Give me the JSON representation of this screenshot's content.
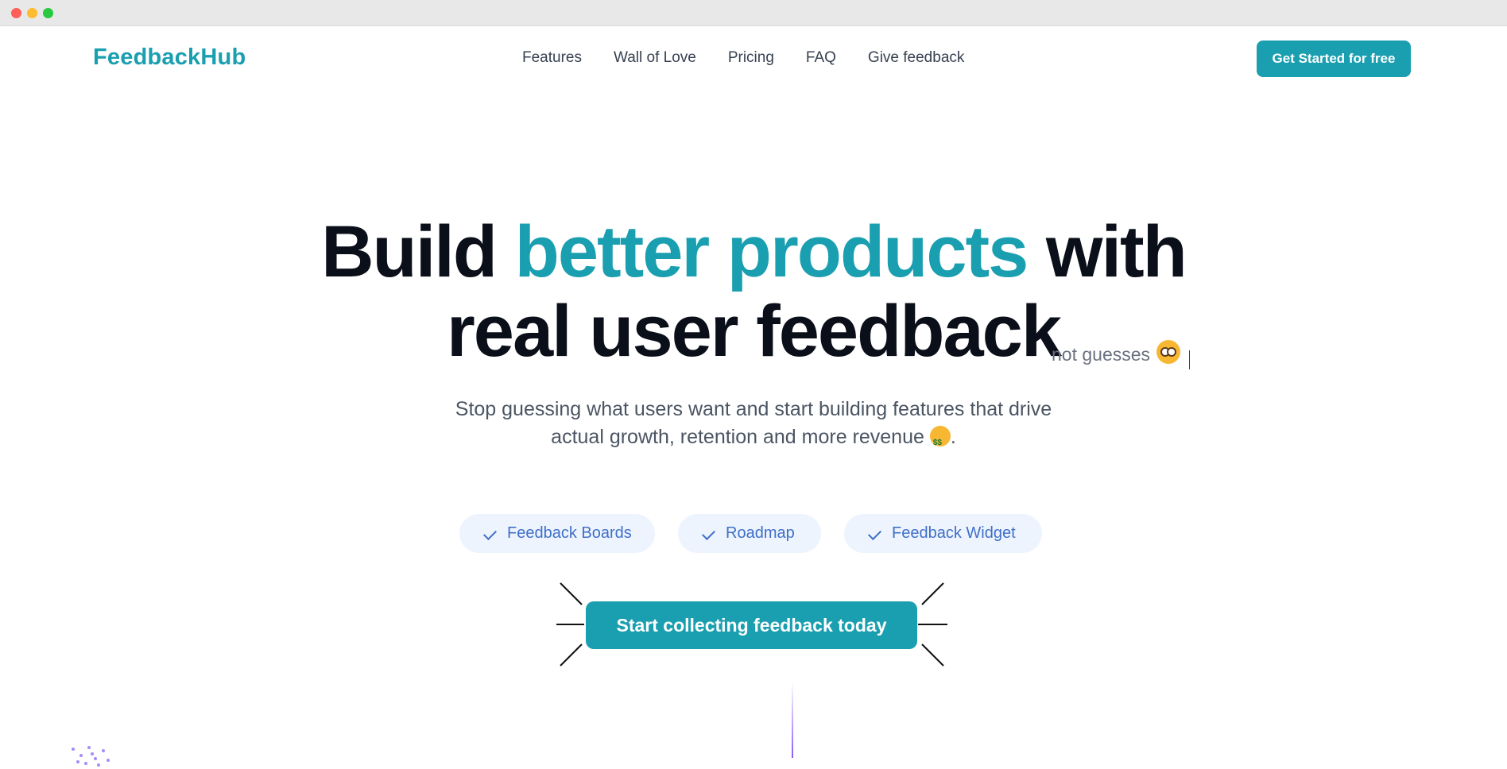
{
  "brand": {
    "name": "FeedbackHub",
    "color": "#1a9fb0"
  },
  "nav": {
    "items": [
      "Features",
      "Wall of Love",
      "Pricing",
      "FAQ",
      "Give feedback"
    ],
    "cta_label": "Get Started for free"
  },
  "hero": {
    "headline_part1": "Build ",
    "headline_accent": "better products",
    "headline_part2": " with",
    "headline_line2": "real user feedback",
    "typed_text": "not guesses",
    "typed_icon": "flushed-face-icon",
    "subtitle": "Stop guessing what users want and start building features that drive actual growth, retention and more revenue",
    "subtitle_icon": "money-mouth-face-icon",
    "subtitle_end": "."
  },
  "features": [
    {
      "label": "Feedback Boards",
      "icon": "check-icon"
    },
    {
      "label": "Roadmap",
      "icon": "check-icon"
    },
    {
      "label": "Feedback Widget",
      "icon": "check-icon"
    }
  ],
  "main_cta": {
    "label": "Start collecting feedback today"
  },
  "colors": {
    "accent": "#1a9fb0",
    "pill_bg": "#eef4fd",
    "pill_text": "#3f6fc9"
  }
}
